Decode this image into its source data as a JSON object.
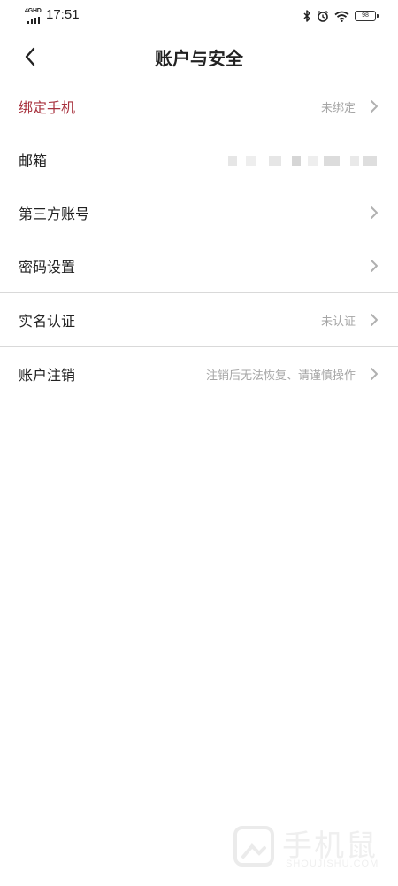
{
  "status_bar": {
    "network": "4GHD",
    "time": "17:51",
    "battery": "98",
    "icons": [
      "bluetooth-icon",
      "alarm-icon",
      "wifi-icon",
      "battery-icon"
    ]
  },
  "header": {
    "back_icon": "chevron-left-icon",
    "title": "账户与安全"
  },
  "rows": [
    {
      "label": "绑定手机",
      "value": "未绑定",
      "accent": "#a8323e",
      "has_chevron": true
    },
    {
      "label": "邮箱",
      "value": "",
      "masked": true,
      "has_chevron": false
    },
    {
      "label": "第三方账号",
      "value": "",
      "has_chevron": true
    },
    {
      "label": "密码设置",
      "value": "",
      "has_chevron": true
    },
    {
      "label": "实名认证",
      "value": "未认证",
      "has_chevron": true
    },
    {
      "label": "账户注销",
      "value": "注销后无法恢复、请谨慎操作",
      "has_chevron": true
    }
  ],
  "watermark": {
    "text": "手机鼠",
    "sub": "SHOUJISHU.COM"
  },
  "colors": {
    "accent": "#a8323e",
    "secondary_text": "#a6a6a6",
    "divider": "#d9d9d9"
  }
}
